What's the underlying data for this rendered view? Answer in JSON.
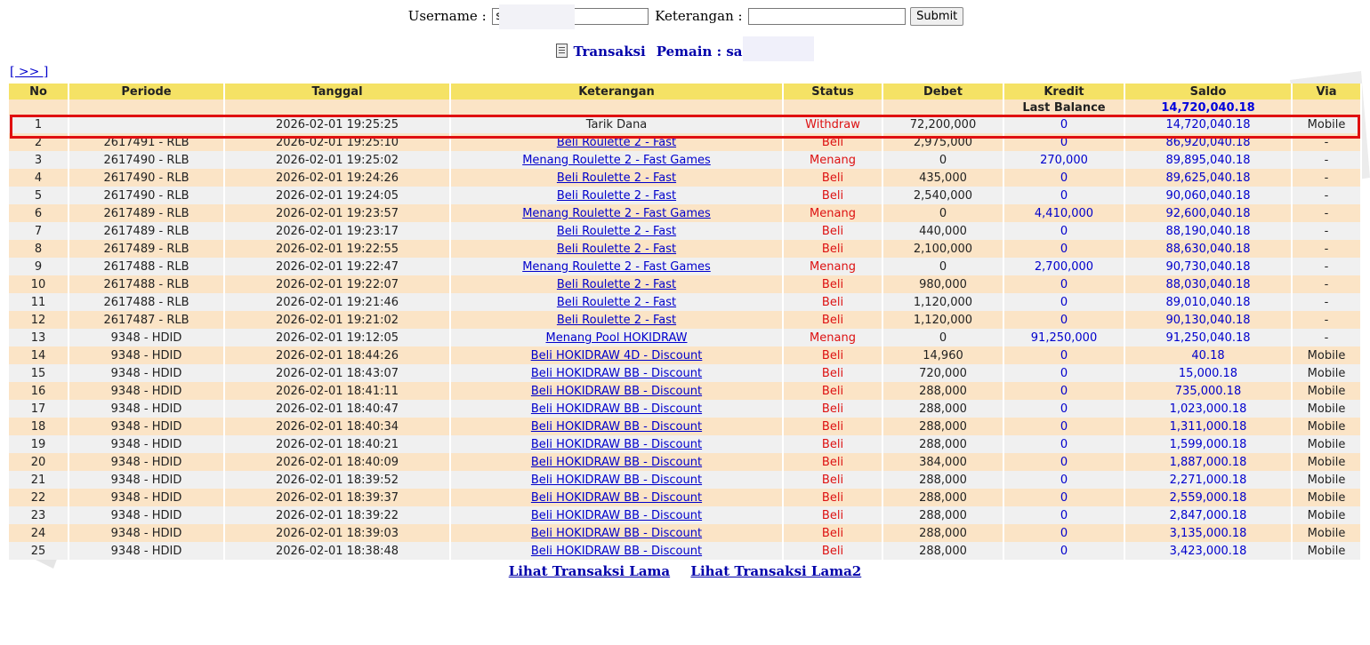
{
  "form": {
    "username_label": "Username :",
    "username_value": "s",
    "keterangan_label": "Keterangan :",
    "keterangan_value": "",
    "submit_label": "Submit"
  },
  "title": {
    "transaksi": "Transaksi",
    "pemain": "Pemain : sa"
  },
  "nav": {
    "next_label": "[ >> ]"
  },
  "columns": [
    "No",
    "Periode",
    "Tanggal",
    "Keterangan",
    "Status",
    "Debet",
    "Kredit",
    "Saldo",
    "Via"
  ],
  "last_balance": {
    "label": "Last Balance",
    "value": "14,720,040.18"
  },
  "rows": [
    {
      "no": "1",
      "periode": "",
      "tanggal": "2026-02-01 19:25:25",
      "keterangan": "Tarik Dana",
      "link": false,
      "status": "Withdraw",
      "debet": "72,200,000",
      "kredit": "0",
      "saldo": "14,720,040.18",
      "via": "Mobile"
    },
    {
      "no": "2",
      "periode": "2617491 - RLB",
      "tanggal": "2026-02-01 19:25:10",
      "keterangan": "Beli Roulette 2 - Fast",
      "link": true,
      "status": "Beli",
      "debet": "2,975,000",
      "kredit": "0",
      "saldo": "86,920,040.18",
      "via": "-"
    },
    {
      "no": "3",
      "periode": "2617490 - RLB",
      "tanggal": "2026-02-01 19:25:02",
      "keterangan": "Menang Roulette 2 - Fast Games",
      "link": true,
      "status": "Menang",
      "debet": "0",
      "kredit": "270,000",
      "saldo": "89,895,040.18",
      "via": "-"
    },
    {
      "no": "4",
      "periode": "2617490 - RLB",
      "tanggal": "2026-02-01 19:24:26",
      "keterangan": "Beli Roulette 2 - Fast",
      "link": true,
      "status": "Beli",
      "debet": "435,000",
      "kredit": "0",
      "saldo": "89,625,040.18",
      "via": "-"
    },
    {
      "no": "5",
      "periode": "2617490 - RLB",
      "tanggal": "2026-02-01 19:24:05",
      "keterangan": "Beli Roulette 2 - Fast",
      "link": true,
      "status": "Beli",
      "debet": "2,540,000",
      "kredit": "0",
      "saldo": "90,060,040.18",
      "via": "-"
    },
    {
      "no": "6",
      "periode": "2617489 - RLB",
      "tanggal": "2026-02-01 19:23:57",
      "keterangan": "Menang Roulette 2 - Fast Games",
      "link": true,
      "status": "Menang",
      "debet": "0",
      "kredit": "4,410,000",
      "saldo": "92,600,040.18",
      "via": "-"
    },
    {
      "no": "7",
      "periode": "2617489 - RLB",
      "tanggal": "2026-02-01 19:23:17",
      "keterangan": "Beli Roulette 2 - Fast",
      "link": true,
      "status": "Beli",
      "debet": "440,000",
      "kredit": "0",
      "saldo": "88,190,040.18",
      "via": "-"
    },
    {
      "no": "8",
      "periode": "2617489 - RLB",
      "tanggal": "2026-02-01 19:22:55",
      "keterangan": "Beli Roulette 2 - Fast",
      "link": true,
      "status": "Beli",
      "debet": "2,100,000",
      "kredit": "0",
      "saldo": "88,630,040.18",
      "via": "-"
    },
    {
      "no": "9",
      "periode": "2617488 - RLB",
      "tanggal": "2026-02-01 19:22:47",
      "keterangan": "Menang Roulette 2 - Fast Games",
      "link": true,
      "status": "Menang",
      "debet": "0",
      "kredit": "2,700,000",
      "saldo": "90,730,040.18",
      "via": "-"
    },
    {
      "no": "10",
      "periode": "2617488 - RLB",
      "tanggal": "2026-02-01 19:22:07",
      "keterangan": "Beli Roulette 2 - Fast",
      "link": true,
      "status": "Beli",
      "debet": "980,000",
      "kredit": "0",
      "saldo": "88,030,040.18",
      "via": "-"
    },
    {
      "no": "11",
      "periode": "2617488 - RLB",
      "tanggal": "2026-02-01 19:21:46",
      "keterangan": "Beli Roulette 2 - Fast",
      "link": true,
      "status": "Beli",
      "debet": "1,120,000",
      "kredit": "0",
      "saldo": "89,010,040.18",
      "via": "-"
    },
    {
      "no": "12",
      "periode": "2617487 - RLB",
      "tanggal": "2026-02-01 19:21:02",
      "keterangan": "Beli Roulette 2 - Fast",
      "link": true,
      "status": "Beli",
      "debet": "1,120,000",
      "kredit": "0",
      "saldo": "90,130,040.18",
      "via": "-"
    },
    {
      "no": "13",
      "periode": "9348 - HDID",
      "tanggal": "2026-02-01 19:12:05",
      "keterangan": "Menang Pool HOKIDRAW",
      "link": true,
      "status": "Menang",
      "debet": "0",
      "kredit": "91,250,000",
      "saldo": "91,250,040.18",
      "via": "-"
    },
    {
      "no": "14",
      "periode": "9348 - HDID",
      "tanggal": "2026-02-01 18:44:26",
      "keterangan": "Beli HOKIDRAW 4D - Discount",
      "link": true,
      "status": "Beli",
      "debet": "14,960",
      "kredit": "0",
      "saldo": "40.18",
      "via": "Mobile"
    },
    {
      "no": "15",
      "periode": "9348 - HDID",
      "tanggal": "2026-02-01 18:43:07",
      "keterangan": "Beli HOKIDRAW BB - Discount",
      "link": true,
      "status": "Beli",
      "debet": "720,000",
      "kredit": "0",
      "saldo": "15,000.18",
      "via": "Mobile"
    },
    {
      "no": "16",
      "periode": "9348 - HDID",
      "tanggal": "2026-02-01 18:41:11",
      "keterangan": "Beli HOKIDRAW BB - Discount",
      "link": true,
      "status": "Beli",
      "debet": "288,000",
      "kredit": "0",
      "saldo": "735,000.18",
      "via": "Mobile"
    },
    {
      "no": "17",
      "periode": "9348 - HDID",
      "tanggal": "2026-02-01 18:40:47",
      "keterangan": "Beli HOKIDRAW BB - Discount",
      "link": true,
      "status": "Beli",
      "debet": "288,000",
      "kredit": "0",
      "saldo": "1,023,000.18",
      "via": "Mobile"
    },
    {
      "no": "18",
      "periode": "9348 - HDID",
      "tanggal": "2026-02-01 18:40:34",
      "keterangan": "Beli HOKIDRAW BB - Discount",
      "link": true,
      "status": "Beli",
      "debet": "288,000",
      "kredit": "0",
      "saldo": "1,311,000.18",
      "via": "Mobile"
    },
    {
      "no": "19",
      "periode": "9348 - HDID",
      "tanggal": "2026-02-01 18:40:21",
      "keterangan": "Beli HOKIDRAW BB - Discount",
      "link": true,
      "status": "Beli",
      "debet": "288,000",
      "kredit": "0",
      "saldo": "1,599,000.18",
      "via": "Mobile"
    },
    {
      "no": "20",
      "periode": "9348 - HDID",
      "tanggal": "2026-02-01 18:40:09",
      "keterangan": "Beli HOKIDRAW BB - Discount",
      "link": true,
      "status": "Beli",
      "debet": "384,000",
      "kredit": "0",
      "saldo": "1,887,000.18",
      "via": "Mobile"
    },
    {
      "no": "21",
      "periode": "9348 - HDID",
      "tanggal": "2026-02-01 18:39:52",
      "keterangan": "Beli HOKIDRAW BB - Discount",
      "link": true,
      "status": "Beli",
      "debet": "288,000",
      "kredit": "0",
      "saldo": "2,271,000.18",
      "via": "Mobile"
    },
    {
      "no": "22",
      "periode": "9348 - HDID",
      "tanggal": "2026-02-01 18:39:37",
      "keterangan": "Beli HOKIDRAW BB - Discount",
      "link": true,
      "status": "Beli",
      "debet": "288,000",
      "kredit": "0",
      "saldo": "2,559,000.18",
      "via": "Mobile"
    },
    {
      "no": "23",
      "periode": "9348 - HDID",
      "tanggal": "2026-02-01 18:39:22",
      "keterangan": "Beli HOKIDRAW BB - Discount",
      "link": true,
      "status": "Beli",
      "debet": "288,000",
      "kredit": "0",
      "saldo": "2,847,000.18",
      "via": "Mobile"
    },
    {
      "no": "24",
      "periode": "9348 - HDID",
      "tanggal": "2026-02-01 18:39:03",
      "keterangan": "Beli HOKIDRAW BB - Discount",
      "link": true,
      "status": "Beli",
      "debet": "288,000",
      "kredit": "0",
      "saldo": "3,135,000.18",
      "via": "Mobile"
    },
    {
      "no": "25",
      "periode": "9348 - HDID",
      "tanggal": "2026-02-01 18:38:48",
      "keterangan": "Beli HOKIDRAW BB - Discount",
      "link": true,
      "status": "Beli",
      "debet": "288,000",
      "kredit": "0",
      "saldo": "3,423,000.18",
      "via": "Mobile"
    }
  ],
  "footer": {
    "lama_label": "Lihat Transaksi Lama",
    "lama2_label": "Lihat Transaksi Lama2"
  },
  "colors": {
    "header_bg": "#f5e265",
    "row_odd": "#f0f0f0",
    "row_even": "#fbe4c6",
    "link": "#0000cc",
    "status": "#dd1111",
    "highlight": "#e01010"
  }
}
